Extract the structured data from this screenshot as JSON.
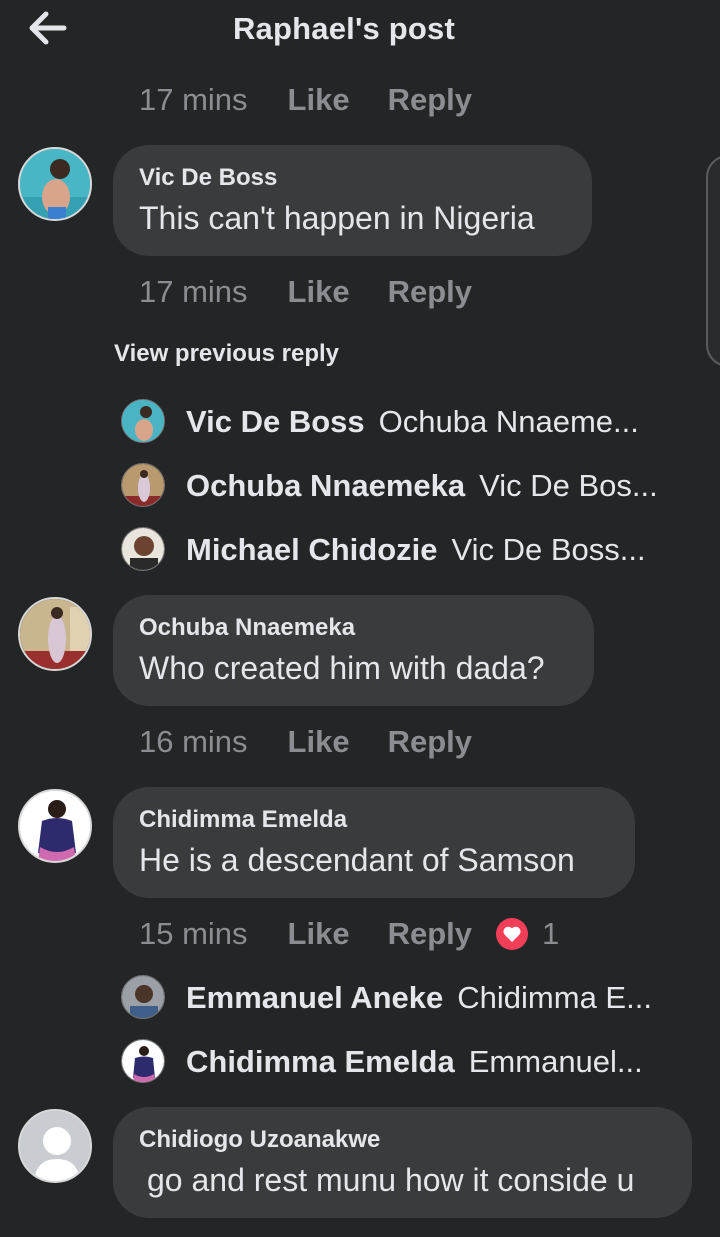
{
  "header": {
    "title": "Raphael's post",
    "back_icon": "arrow-left-icon"
  },
  "top_meta": {
    "time": "17 mins",
    "like": "Like",
    "reply": "Reply"
  },
  "comments": [
    {
      "author": "Vic De Boss",
      "text": "This can't happen in Nigeria",
      "meta": {
        "time": "17 mins",
        "like": "Like",
        "reply": "Reply"
      }
    },
    {
      "author": "Ochuba Nnaemeka",
      "text": "Who created him with dada?",
      "meta": {
        "time": "16 mins",
        "like": "Like",
        "reply": "Reply"
      }
    },
    {
      "author": "Chidimma Emelda",
      "text": "He is a descendant of Samson",
      "meta": {
        "time": "15 mins",
        "like": "Like",
        "reply": "Reply",
        "reaction": "heart-icon",
        "reaction_count": "1"
      }
    },
    {
      "author": "Chidiogo Uzoanakwe",
      "text": "go and rest munu how it conside u"
    }
  ],
  "view_previous": "View previous reply",
  "replies_group_1": [
    {
      "name": "Vic De Boss",
      "snippet": "Ochuba Nnaeme..."
    },
    {
      "name": "Ochuba Nnaemeka",
      "snippet": "Vic De Bos..."
    },
    {
      "name": "Michael Chidozie",
      "snippet": "Vic De Boss..."
    }
  ],
  "replies_group_2": [
    {
      "name": "Emmanuel Aneke",
      "snippet": "Chidimma E..."
    },
    {
      "name": "Chidimma Emelda",
      "snippet": "Emmanuel..."
    }
  ],
  "colors": {
    "background": "#242526",
    "bubble": "#3a3b3c",
    "muted": "#8a8d91",
    "heart": "#f33e58"
  }
}
